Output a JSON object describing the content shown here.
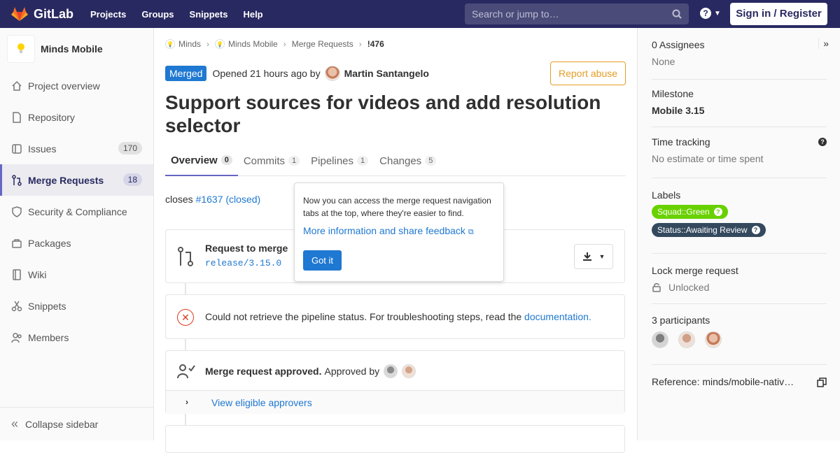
{
  "navbar": {
    "brand": "GitLab",
    "links": [
      "Projects",
      "Groups",
      "Snippets",
      "Help"
    ],
    "search_placeholder": "Search or jump to…",
    "signin": "Sign in / Register"
  },
  "sidebar": {
    "project_name": "Minds Mobile",
    "items": [
      {
        "label": "Project overview"
      },
      {
        "label": "Repository"
      },
      {
        "label": "Issues",
        "count": "170"
      },
      {
        "label": "Merge Requests",
        "count": "18"
      },
      {
        "label": "Security & Compliance"
      },
      {
        "label": "Packages"
      },
      {
        "label": "Wiki"
      },
      {
        "label": "Snippets"
      },
      {
        "label": "Members"
      }
    ],
    "collapse": "Collapse sidebar"
  },
  "breadcrumb": [
    "Minds",
    "Minds Mobile",
    "Merge Requests",
    "!476"
  ],
  "mr": {
    "status": "Merged",
    "opened": "Opened 21 hours ago by",
    "author": "Martin Santangelo",
    "report": "Report abuse",
    "title": "Support sources for videos and add resolution selector",
    "tabs": [
      {
        "label": "Overview",
        "count": "0"
      },
      {
        "label": "Commits",
        "count": "1"
      },
      {
        "label": "Pipelines",
        "count": "1"
      },
      {
        "label": "Changes",
        "count": "5"
      }
    ],
    "closes_prefix": "closes",
    "closes_link": "#1637 (closed)",
    "request_title": "Request to merge",
    "branch": "release/3.15.0",
    "pipeline_error": "Could not retrieve the pipeline status. For troubleshooting steps, read the",
    "pipeline_link": "documentation.",
    "approved": "Merge request approved.",
    "approved_by": "Approved by",
    "eligible": "View eligible approvers"
  },
  "popover": {
    "text": "Now you can access the merge request navigation tabs at the top, where they're easier to find.",
    "link": "More information and share feedback",
    "button": "Got it"
  },
  "right": {
    "assignees_title": "0 Assignees",
    "assignees_value": "None",
    "milestone_title": "Milestone",
    "milestone_value": "Mobile 3.15",
    "time_title": "Time tracking",
    "time_value": "No estimate or time spent",
    "labels_title": "Labels",
    "labels": [
      {
        "text": "Squad::Green",
        "color": "#69d100"
      },
      {
        "text": "Status::Awaiting Review",
        "color": "#34495e"
      }
    ],
    "lock_title": "Lock merge request",
    "lock_value": "Unlocked",
    "participants_title": "3 participants",
    "reference": "Reference: minds/mobile-nativ…"
  },
  "colors": {
    "accent": "#1f78d1",
    "navbar": "#292961",
    "warning": "#e49d24",
    "danger": "#db3b21"
  }
}
